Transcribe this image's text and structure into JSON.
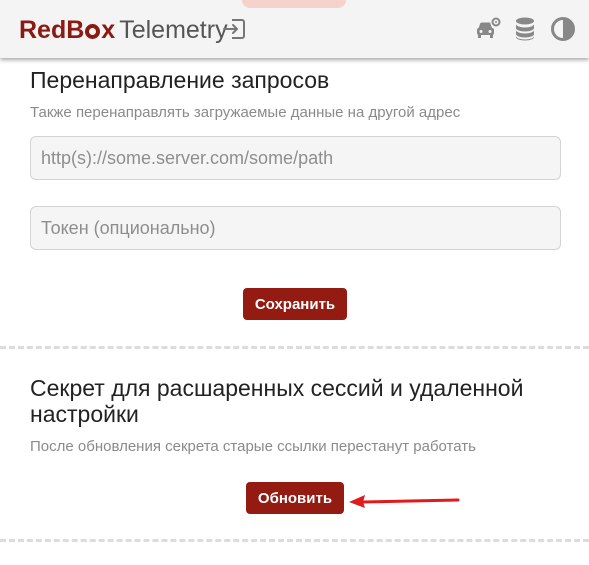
{
  "header": {
    "brand": "RedBox",
    "brand_parts": [
      "RedB",
      "x"
    ],
    "product": "Telemetry",
    "icons": [
      "logout-icon",
      "car-settings-icon",
      "database-icon",
      "theme-toggle-icon"
    ]
  },
  "redirect_section": {
    "title": "Перенаправление запросов",
    "note": "Также перенаправлять загружаемые данные на другой адрес",
    "url_placeholder": "http(s)://some.server.com/some/path",
    "url_value": "",
    "token_placeholder": "Токен (опционально)",
    "token_value": "",
    "save_label": "Сохранить"
  },
  "secret_section": {
    "title_line1": "Секрет для расшаренных сессий и удаленной",
    "title_line2": "настройки",
    "note": "После обновления секрета старые ссылки перестанут работать",
    "update_label": "Обновить"
  },
  "colors": {
    "brand": "#8b1a12",
    "button": "#941b11",
    "annotation": "#e01b1b"
  }
}
